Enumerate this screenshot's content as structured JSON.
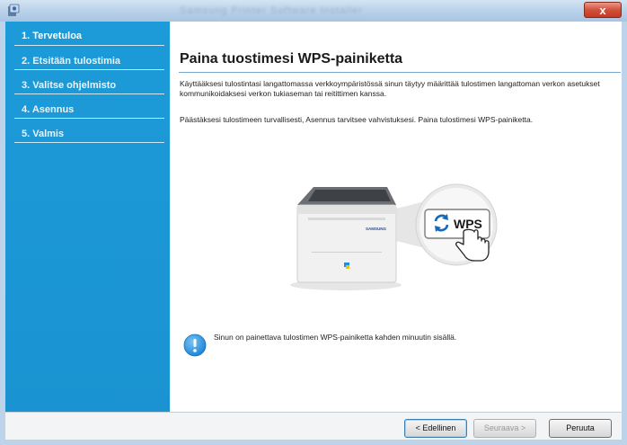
{
  "window": {
    "title": "Samsung Printer Software Installer",
    "close_label": "x"
  },
  "sidebar": {
    "steps": [
      {
        "label": "1. Tervetuloa"
      },
      {
        "label": "2. Etsitään tulostimia"
      },
      {
        "label": "3. Valitse ohjelmisto"
      },
      {
        "label": "4. Asennus"
      },
      {
        "label": "5. Valmis"
      }
    ]
  },
  "main": {
    "heading": "Paina  tuostimesi WPS-painiketta",
    "paragraph1": "Käyttääksesi tulostintasi langattomassa verkkoympäristössä sinun täytyy määrittää tulostimen langattoman verkon asetukset kommunikoidaksesi verkon tukiaseman tai reitittimen kanssa.",
    "paragraph2": "Päästäksesi tulostimeen turvallisesti, Asennus tarvitsee vahvistuksesi. Paina tulostimesi WPS-painiketta.",
    "illustration": {
      "printer_brand": "SAMSUNG",
      "wps_label": "WPS"
    },
    "info_text": "Sinun on painettava tulostimen WPS-painiketta kahden minuutin sisällä."
  },
  "buttons": {
    "back": "< Edellinen",
    "next": "Seuraava >",
    "cancel": "Peruuta"
  },
  "colors": {
    "sidebar": "#1c9bd8",
    "accent": "#3c7fb1",
    "info": "#1e86d6",
    "wps_icon": "#1769b7"
  },
  "icons": {
    "app": "installer-app-icon",
    "close": "close-icon",
    "info": "info-icon",
    "wps": "wps-refresh-icon",
    "hand": "hand-pointer-icon"
  }
}
